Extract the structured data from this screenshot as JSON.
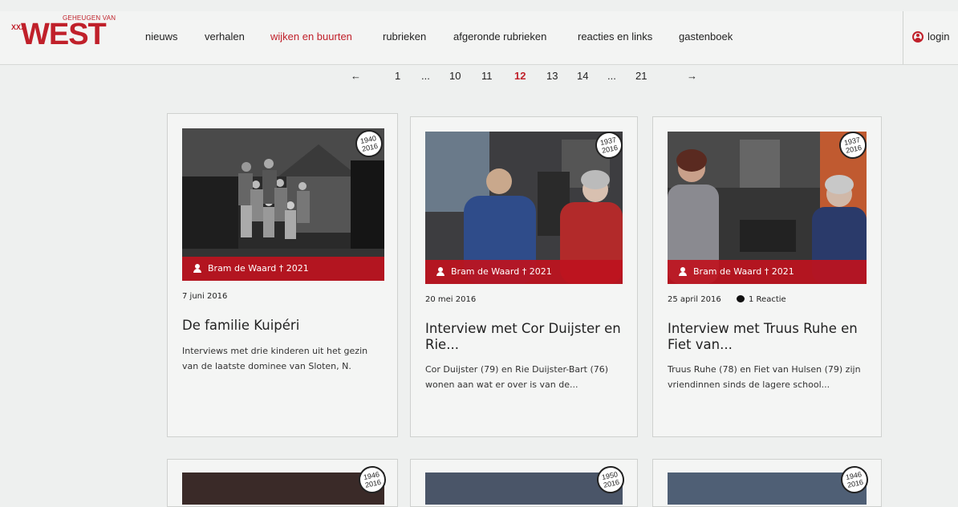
{
  "brand": {
    "top_text": "GEHEUGEN VAN",
    "word": "WEST",
    "xs": "XXX"
  },
  "nav": {
    "items": [
      {
        "label": "nieuws"
      },
      {
        "label": "verhalen"
      },
      {
        "label": "wijken en buurten"
      },
      {
        "label": "rubrieken"
      },
      {
        "label": "afgeronde rubrieken"
      },
      {
        "label": "reacties en links"
      },
      {
        "label": "gastenboek"
      }
    ],
    "active": "wijken en buurten",
    "login": "login"
  },
  "pagination": {
    "prev": "←",
    "items": [
      "1",
      "...",
      "10",
      "11",
      "12",
      "13",
      "14",
      "...",
      "21"
    ],
    "current": "12",
    "next": "→"
  },
  "cards": [
    {
      "badge_top": "1940",
      "badge_bottom": "2016",
      "author": "Bram de Waard † 2021",
      "date": "7 juni 2016",
      "title": "De familie Kuipéri",
      "excerpt": "Interviews met drie kinderen uit het gezin van de laatste dominee van Sloten, N."
    },
    {
      "badge_top": "1937",
      "badge_bottom": "2016",
      "author": "Bram de Waard † 2021",
      "date": "20 mei 2016",
      "title": "Interview met Cor Duijster en Rie...",
      "excerpt": "Cor Duijster (79) en Rie Duijster-Bart (76) wonen aan wat er over is van de..."
    },
    {
      "badge_top": "1937",
      "badge_bottom": "2016",
      "author": "Bram de Waard † 2021",
      "date": "25 april 2016",
      "reactions": "1 Reactie",
      "title": "Interview met Truus Ruhe en Fiet van...",
      "excerpt": "Truus Ruhe (78) en Fiet van Hulsen (79) zijn vriendinnen sinds de lagere school..."
    }
  ],
  "next_row_badges": [
    {
      "top": "1946",
      "bottom": "2016"
    },
    {
      "top": "1950",
      "bottom": "2016"
    },
    {
      "top": "1946",
      "bottom": "2016"
    }
  ],
  "colors": {
    "accent": "#c0202a",
    "background": "#eef0ef"
  },
  "icons": {
    "login": "user-circle-icon",
    "author": "person-icon",
    "reaction": "speech-bubble-icon"
  }
}
